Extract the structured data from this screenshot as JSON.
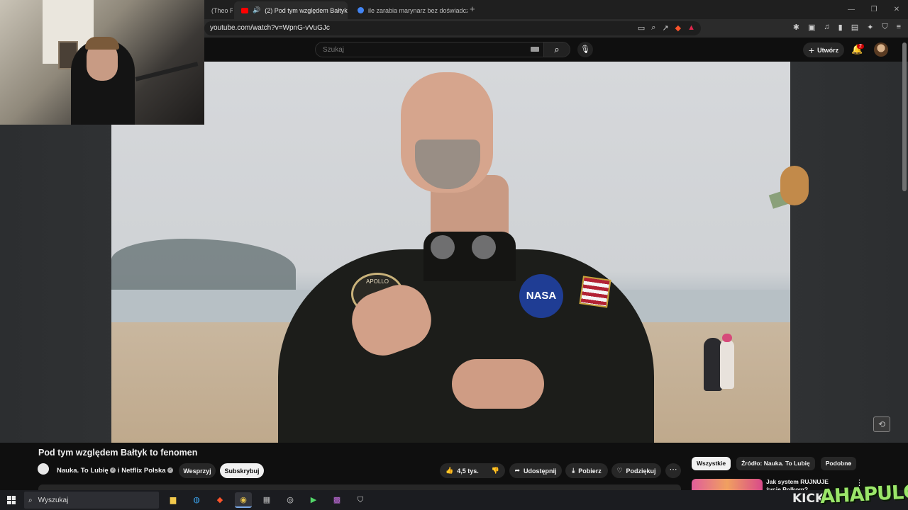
{
  "browser": {
    "tabs": [
      {
        "title": "(Theo R",
        "active": false
      },
      {
        "title": "(2) Pod tym względem Bałtyk",
        "active": true
      },
      {
        "title": "ile zarabia marynarz bez doświadczen",
        "active": false
      }
    ],
    "new_tab": "+",
    "url": "youtube.com/watch?v=WpnG-vVuGJc"
  },
  "youtube": {
    "search_placeholder": "Szukaj",
    "create_label": "Utwórz",
    "notification_count": "2"
  },
  "video": {
    "title": "Pod tym względem Bałtyk to fenomen",
    "channel": "Nauka. To Lubię",
    "collab_prefix": "i",
    "collab_channel": "Netflix Polska",
    "support_label": "Wesprzyj",
    "subscribe_label": "Subskrybuj",
    "likes": "4,5 tys.",
    "share_label": "Udostępnij",
    "download_label": "Pobierz",
    "thanks_label": "Podziękuj",
    "jacket_patch": "NASA",
    "apollo_patch": "APOLLO"
  },
  "sidebar": {
    "chips": [
      "Wszystkie",
      "Źródło: Nauka. To Lubię",
      "Podobne"
    ],
    "recommended": [
      {
        "title": "Jak system RUJNUJE życie Polkom?"
      }
    ]
  },
  "taskbar": {
    "search_placeholder": "Wyszukaj"
  },
  "overlay": {
    "kick_label": "KICK",
    "streamer_name": "AHAPULCO"
  }
}
